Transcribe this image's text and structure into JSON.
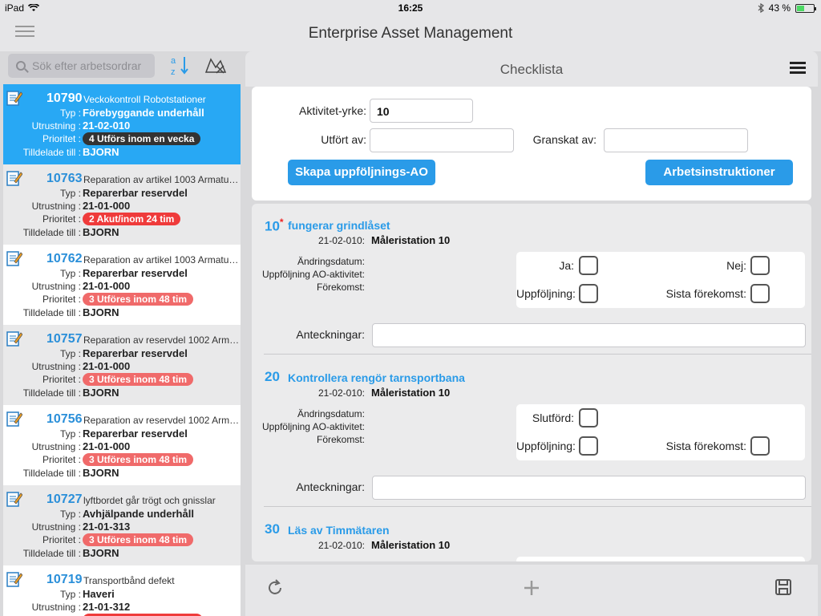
{
  "statusbar": {
    "device": "iPad",
    "time": "16:25",
    "battery": "43 %",
    "battery_level": 0.43
  },
  "app": {
    "title": "Enterprise Asset Management"
  },
  "search": {
    "placeholder": "Sök efter arbetsordrar"
  },
  "labels": {
    "typ": "Typ :",
    "utrustning": "Utrustning :",
    "prioritet": "Prioritet :",
    "tilldelade": "Tilldelade till :"
  },
  "workorders": [
    {
      "num": "10790",
      "desc": "Veckokontroll Robotstationer",
      "typ": "Förebyggande underhåll",
      "utrustning": "21-02-010",
      "prioritet": "4 Utförs inom en vecka",
      "prio_color": "dark",
      "tilldelade": "BJORN"
    },
    {
      "num": "10763",
      "desc": "Reparation av artikel 1003 Armatu…",
      "typ": "Reparerbar reservdel",
      "utrustning": "21-01-000",
      "prioritet": "2 Akut/inom 24 tim",
      "prio_color": "red",
      "tilldelade": "BJORN"
    },
    {
      "num": "10762",
      "desc": "Reparation av artikel 1003 Armatu…",
      "typ": "Reparerbar reservdel",
      "utrustning": "21-01-000",
      "prioritet": "3 Utföres inom 48 tim",
      "prio_color": "pink",
      "tilldelade": "BJORN"
    },
    {
      "num": "10757",
      "desc": "Reparation av reservdel 1002 Arm…",
      "typ": "Reparerbar reservdel",
      "utrustning": "21-01-000",
      "prioritet": "3 Utföres inom 48 tim",
      "prio_color": "pink",
      "tilldelade": "BJORN"
    },
    {
      "num": "10756",
      "desc": "Reparation av reservdel 1002 Arm…",
      "typ": "Reparerbar reservdel",
      "utrustning": "21-01-000",
      "prioritet": "3 Utföres inom 48 tim",
      "prio_color": "pink",
      "tilldelade": "BJORN"
    },
    {
      "num": "10727",
      "desc": "lyftbordet går trögt och gnisslar",
      "typ": "Avhjälpande underhåll",
      "utrustning": "21-01-313",
      "prioritet": "3 Utföres inom 48 tim",
      "prio_color": "pink",
      "tilldelade": "BJORN"
    },
    {
      "num": "10719",
      "desc": "Transportbånd defekt",
      "typ": "Haveri",
      "utrustning": "21-01-312",
      "prioritet": "",
      "prio_color": "red",
      "tilldelade": ""
    }
  ],
  "checklist": {
    "title": "Checklista",
    "form": {
      "aktivitet_label": "Aktivitet-yrke:",
      "aktivitet_value": "10",
      "utfort_label": "Utfört av:",
      "utfort_value": "",
      "granskat_label": "Granskat av:",
      "granskat_value": "",
      "followup_button": "Skapa uppföljnings-AO",
      "instructions_button": "Arbetsinstruktioner"
    },
    "meta_labels": {
      "andringsdatum": "Ändringsdatum:",
      "uppfoljning_ao": "Uppföljning AO-aktivitet:",
      "forekomst": "Förekomst:",
      "anteckningar": "Anteckningar:",
      "ja": "Ja:",
      "nej": "Nej:",
      "slutford": "Slutförd:",
      "uppfoljning": "Uppföljning:",
      "sista_forekomst": "Sista förekomst:"
    },
    "tasks": [
      {
        "num": "10",
        "required": "*",
        "title": "fungerar grindlåset",
        "eq_label": "21-02-010:",
        "eq_value": "Måleristation 10"
      },
      {
        "num": "20",
        "required": "",
        "title": "Kontrollera rengör tarnsportbana",
        "eq_label": "21-02-010:",
        "eq_value": "Måleristation 10"
      },
      {
        "num": "30",
        "required": "",
        "title": "Läs av Timmätaren",
        "eq_label": "21-02-010:",
        "eq_value": "Måleristation 10"
      }
    ]
  },
  "icons": {
    "menu": "hamburger-icon",
    "sort": "sort-az-icon",
    "map": "map-icon",
    "list_menu": "list-menu-icon",
    "refresh": "refresh-icon",
    "add": "plus-icon",
    "save": "save-icon",
    "doc": "edit-document-icon"
  },
  "colors": {
    "accent": "#2a9be8",
    "selected": "#28a8f4",
    "prio_dark": "#333333",
    "prio_red": "#ef3b3b",
    "prio_pink": "#f06a6a"
  }
}
